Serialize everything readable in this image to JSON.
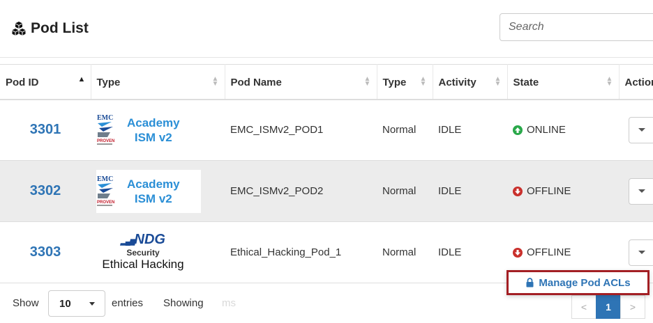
{
  "header": {
    "title": "Pod List",
    "search_placeholder": "Search"
  },
  "table": {
    "columns": [
      {
        "label": "Pod ID",
        "sort": "asc"
      },
      {
        "label": "Type",
        "sort": "both"
      },
      {
        "label": "Pod Name",
        "sort": "both"
      },
      {
        "label": "Type",
        "sort": "both"
      },
      {
        "label": "Activity",
        "sort": "both"
      },
      {
        "label": "State",
        "sort": "both"
      },
      {
        "label": "Action",
        "sort": "none"
      }
    ],
    "rows": [
      {
        "pod_id": "3301",
        "logo_text_1": "Academy",
        "logo_text_2": "ISM v2",
        "pod_name": "EMC_ISMv2_POD1",
        "type": "Normal",
        "activity": "IDLE",
        "state": "ONLINE"
      },
      {
        "pod_id": "3302",
        "logo_text_1": "Academy",
        "logo_text_2": "ISM v2",
        "pod_name": "EMC_ISMv2_POD2",
        "type": "Normal",
        "activity": "IDLE",
        "state": "OFFLINE"
      },
      {
        "pod_id": "3303",
        "logo_ndg": "NDG",
        "logo_sec": "Security",
        "logo_eth": "Ethical Hacking",
        "pod_name": "Ethical_Hacking_Pod_1",
        "type": "Normal",
        "activity": "IDLE",
        "state": "OFFLINE"
      }
    ]
  },
  "footer": {
    "show_label": "Show",
    "page_length": "10",
    "entries_label": "entries",
    "showing_label": "Showing",
    "showing_faded": "ms",
    "pages": [
      "<",
      "1",
      ">"
    ]
  },
  "popup": {
    "label": "Manage Pod ACLs"
  },
  "colors": {
    "accent": "#2e74b5",
    "online": "#2aa84a",
    "offline": "#c9302c",
    "highlight_border": "#a31f24"
  }
}
